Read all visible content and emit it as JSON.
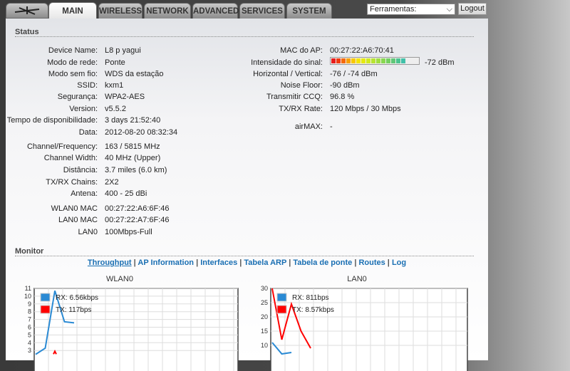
{
  "tabs": [
    {
      "label": "MAIN",
      "active": true
    },
    {
      "label": "WIRELESS"
    },
    {
      "label": "NETWORK"
    },
    {
      "label": "ADVANCED"
    },
    {
      "label": "SERVICES"
    },
    {
      "label": "SYSTEM"
    }
  ],
  "tools_select": "Ferramentas:",
  "logout": "Logout",
  "status": {
    "heading": "Status",
    "left": [
      {
        "label": "Device Name:",
        "value": "L8 p yagui"
      },
      {
        "label": "Modo de rede:",
        "value": "Ponte"
      },
      {
        "label": "Modo sem fio:",
        "value": "WDS da estação"
      },
      {
        "label": "SSID:",
        "value": "kxm1"
      },
      {
        "label": "Segurança:",
        "value": "WPA2-AES"
      },
      {
        "label": "Version:",
        "value": "v5.5.2"
      },
      {
        "label": "Tempo de disponibilidade:",
        "value": "3 days 21:52:40"
      },
      {
        "label": "Data:",
        "value": "2012-08-20 08:32:34"
      },
      {
        "label": "Channel/Frequency:",
        "value": "163 / 5815 MHz"
      },
      {
        "label": "Channel Width:",
        "value": "40 MHz (Upper)"
      },
      {
        "label": "Distância:",
        "value": "3.7 miles (6.0 km)"
      },
      {
        "label": "TX/RX Chains:",
        "value": "2X2"
      },
      {
        "label": "Antena:",
        "value": "400 - 25 dBi"
      },
      {
        "label": "WLAN0 MAC",
        "value": "00:27:22:A6:6F:46"
      },
      {
        "label": "LAN0 MAC",
        "value": "00:27:22:A7:6F:46"
      },
      {
        "label": "LAN0",
        "value": "100Mbps-Full"
      }
    ],
    "right": [
      {
        "label": "MAC do AP:",
        "value": "00:27:22:A6:70:41"
      },
      {
        "label": "Intensidade do sinal:",
        "value": "-72 dBm",
        "bars": 15,
        "bars_total": 17
      },
      {
        "label": "Horizontal / Vertical:",
        "value": "-76 / -74 dBm"
      },
      {
        "label": "Noise Floor:",
        "value": "-90 dBm"
      },
      {
        "label": "Transmitir CCQ:",
        "value": "96.8 %"
      },
      {
        "label": "TX/RX Rate:",
        "value": "120 Mbps / 30 Mbps"
      },
      {
        "label": "airMAX:",
        "value": "-"
      }
    ]
  },
  "monitor": {
    "heading": "Monitor",
    "links": [
      "Throughput",
      "AP Information",
      "Interfaces",
      "Tabela ARP",
      "Tabela de ponte",
      "Routes",
      "Log"
    ]
  },
  "chart_data": [
    {
      "type": "line",
      "title": "WLAN0",
      "ylim": [
        2,
        11
      ],
      "yticks": [
        3,
        4,
        5,
        6,
        7,
        8,
        9,
        10,
        11
      ],
      "series": [
        {
          "name": "RX",
          "legend": "RX: 6.56kbps",
          "color": "#2a8ad4",
          "values": [
            2.5,
            3.3,
            10.7,
            6.7,
            6.56
          ]
        },
        {
          "name": "TX",
          "legend": "TX: 117bps",
          "color": "#ff0000",
          "values": [
            null,
            null,
            2.9
          ]
        }
      ]
    },
    {
      "type": "line",
      "title": "LAN0",
      "ylim": [
        7,
        30
      ],
      "yticks": [
        10,
        15,
        20,
        25,
        30
      ],
      "series": [
        {
          "name": "RX",
          "legend": "RX: 811bps",
          "color": "#2a8ad4",
          "values": [
            11,
            7,
            7.5
          ]
        },
        {
          "name": "TX",
          "legend": "TX: 8.57kbps",
          "color": "#ff0000",
          "values": [
            30,
            12,
            24.5,
            15,
            9
          ]
        }
      ]
    }
  ]
}
